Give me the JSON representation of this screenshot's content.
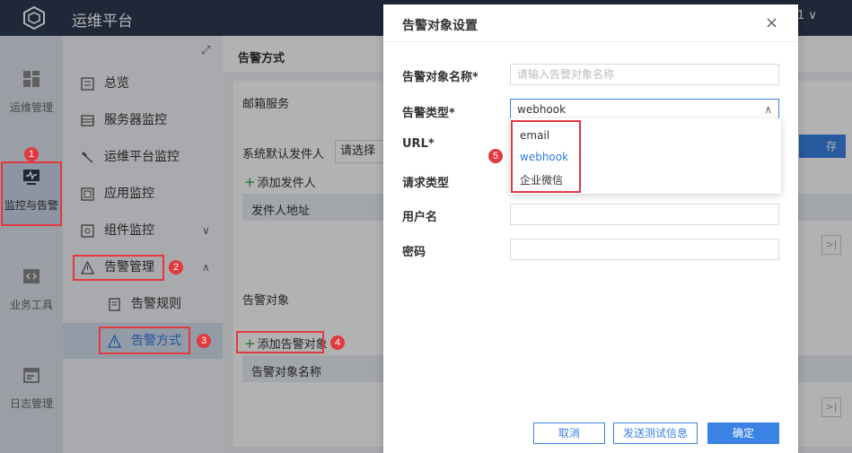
{
  "app": {
    "title": "运维平台",
    "user_badge": "1"
  },
  "rail": {
    "items": [
      {
        "label": "运维管理",
        "icon": "dashboard-icon"
      },
      {
        "label": "监控与告警",
        "icon": "monitor-icon"
      },
      {
        "label": "业务工具",
        "icon": "code-icon"
      },
      {
        "label": "日志管理",
        "icon": "calendar-icon"
      }
    ]
  },
  "menu": {
    "items": [
      {
        "label": "总览"
      },
      {
        "label": "服务器监控"
      },
      {
        "label": "运维平台监控"
      },
      {
        "label": "应用监控"
      },
      {
        "label": "组件监控"
      },
      {
        "label": "告警管理"
      },
      {
        "label": "告警规则"
      },
      {
        "label": "告警方式"
      }
    ]
  },
  "content": {
    "title": "告警方式",
    "email_card": {
      "title": "邮箱服务",
      "sender_label": "系统默认发件人",
      "sender_select": "请选择",
      "add_sender": "添加发件人",
      "table_header": "发件人地址",
      "save_fragment": "存"
    },
    "target_card": {
      "title": "告警对象",
      "add_target": "添加告警对象",
      "table_header": "告警对象名称"
    }
  },
  "dialog": {
    "title": "告警对象设置",
    "close": "×",
    "fields": {
      "name": {
        "label": "告警对象名称*",
        "placeholder": "请输入告警对象名称"
      },
      "type": {
        "label": "告警类型*",
        "value": "webhook"
      },
      "url": {
        "label": "URL*"
      },
      "request_type": {
        "label": "请求类型"
      },
      "username": {
        "label": "用户名"
      },
      "password": {
        "label": "密码"
      }
    },
    "type_options": [
      "email",
      "webhook",
      "企业微信"
    ],
    "selected_option": "webhook",
    "buttons": {
      "cancel": "取消",
      "test": "发送测试信息",
      "confirm": "确定"
    }
  },
  "annotations": [
    "1",
    "2",
    "3",
    "4",
    "5"
  ],
  "colors": {
    "accent": "#3a82e4",
    "annotation": "#e0393e",
    "topbar": "#2b3a52"
  }
}
